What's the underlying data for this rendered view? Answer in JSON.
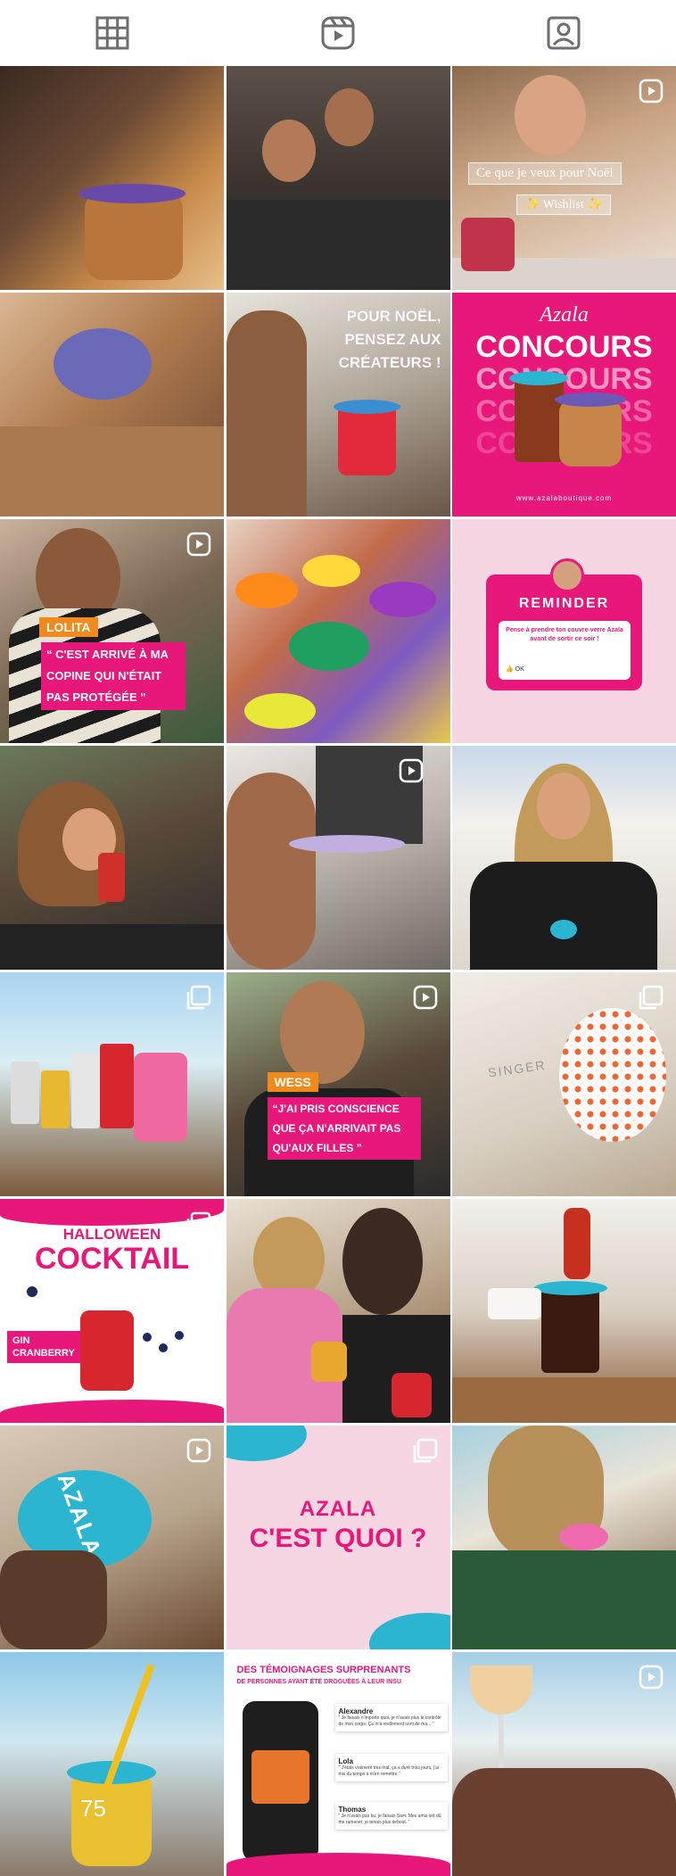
{
  "tabs": [
    {
      "icon": "grid-icon"
    },
    {
      "icon": "reels-icon"
    },
    {
      "icon": "tagged-icon"
    }
  ],
  "colors": {
    "pink": "#e8187a",
    "cyan": "#2bb5d0",
    "light_pink": "#f7d6e4"
  },
  "posts": {
    "wishlist": {
      "line1": "Ce que je veux pour Noël",
      "line2": "✨ Wishlist ✨"
    },
    "createurs": {
      "text": "POUR NOËL, PENSEZ AUX CRÉATEURS !"
    },
    "concours": {
      "brand": "Azala",
      "title": "CONCOURS",
      "site": "www.azalaboutique.com"
    },
    "lolita": {
      "name": "LOLITA",
      "quote": "“ C'EST ARRIVÉ À MA COPINE QUI N'ÉTAIT PAS PROTÉGÉE ”"
    },
    "reminder": {
      "title": "REMINDER",
      "text": "Pense à prendre ton couvre-verre Azala avant de sortir ce soir !",
      "ok": "👍 OK"
    },
    "wess": {
      "name": "WESS",
      "quote": "“J'AI PRIS CONSCIENCE QUE ÇA N'ARRIVAIT PAS QU'AUX FILLES ”"
    },
    "singer": {
      "text": "SINGER"
    },
    "halloween": {
      "line1": "HALLOWEEN",
      "line2": "COCKTAIL",
      "label": "GIN CRANBERRY"
    },
    "azala_cup": {
      "text": "AZALA"
    },
    "cestquoi": {
      "line1": "AZALA",
      "line2": "C'EST QUOI ?"
    },
    "overlay_count": "75",
    "temoignages": {
      "title": "DES TÉMOIGNAGES SURPRENANTS",
      "subtitle": "DE PERSONNES AYANT ÉTÉ DROGUÉES À LEUR INSU",
      "cards": [
        {
          "name": "Alexandre",
          "text": "\" Je faisais n'importe quoi, je n'avais plus le contrôle de mon corps. Ça m'a réellement sorti de ma... \""
        },
        {
          "name": "Lola",
          "text": "\" J'étais vraiment très mal, ça a duré trois jours, j'ai mis du temps à m'en remettre \""
        },
        {
          "name": "Thomas",
          "text": "\" Je n'avais pas bu, je faisais Sam. Mes amis ont dû me ramener, je tenais plus debout. \""
        }
      ]
    }
  }
}
